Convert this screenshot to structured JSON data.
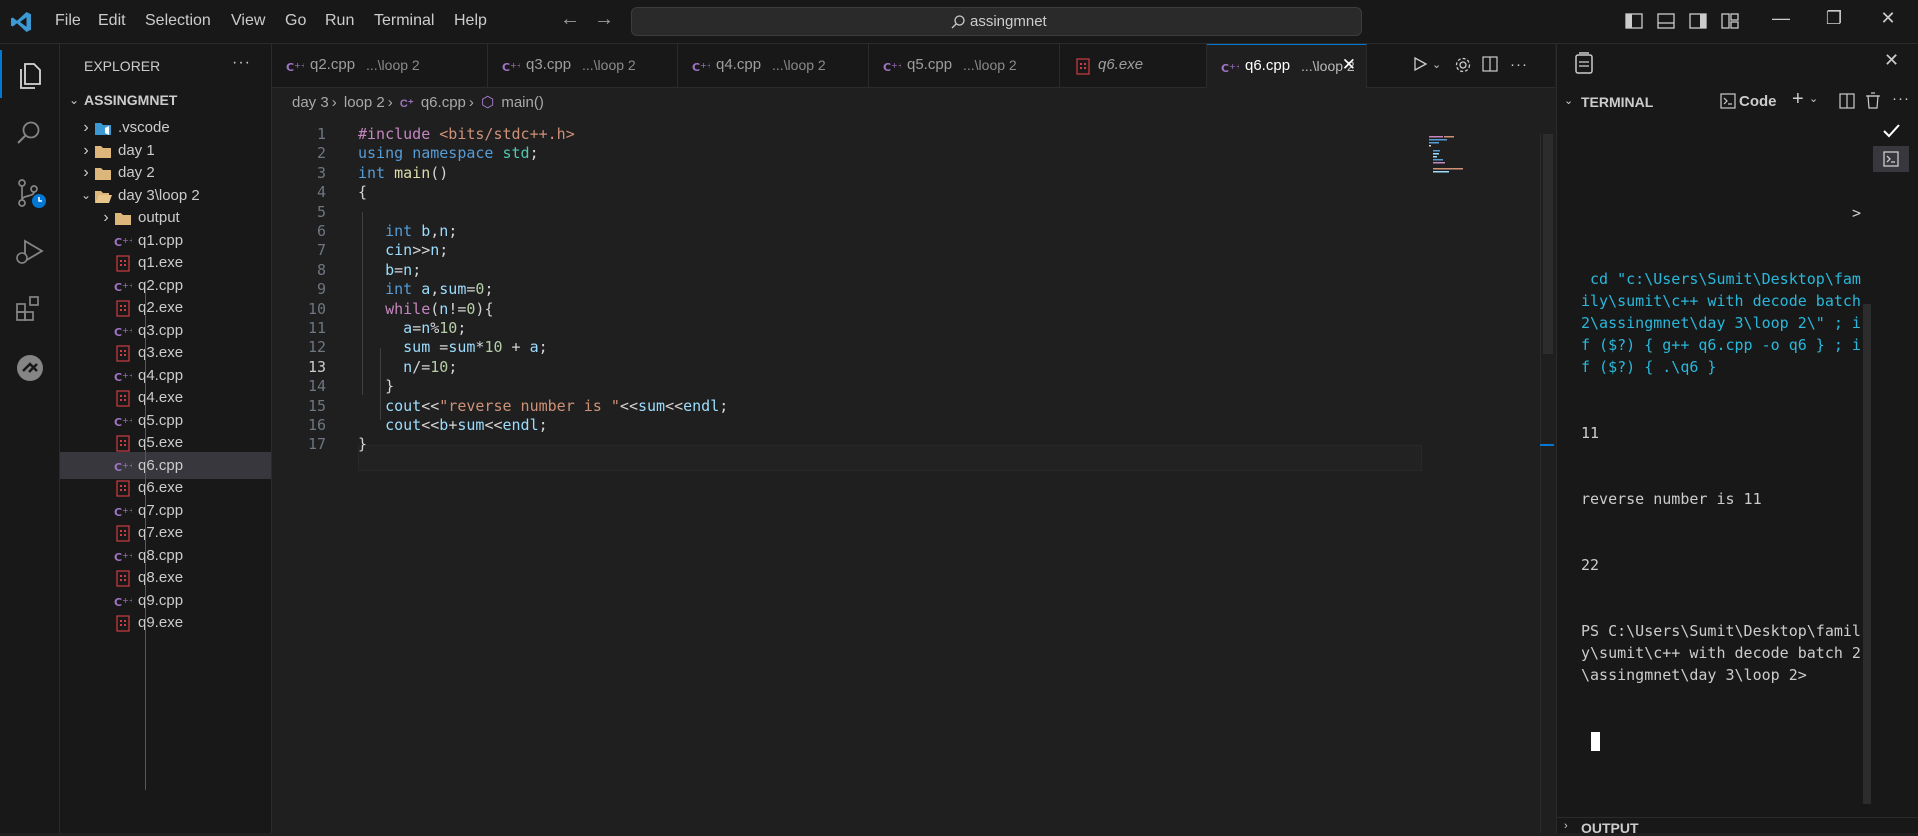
{
  "titlebar": {
    "menu": [
      "File",
      "Edit",
      "Selection",
      "View",
      "Go",
      "Run",
      "Terminal",
      "Help"
    ],
    "search_text": "assingmnet",
    "accent": "#0078d4"
  },
  "explorer": {
    "title": "EXPLORER",
    "more": "···",
    "root": "ASSINGMNET",
    "items": [
      {
        "label": ".vscode",
        "kind": "vscode-folder",
        "level": 1,
        "expanded": false
      },
      {
        "label": "day 1",
        "kind": "folder",
        "level": 1,
        "expanded": false
      },
      {
        "label": "day 2",
        "kind": "folder",
        "level": 1,
        "expanded": false
      },
      {
        "label": "day 3\\loop 2",
        "kind": "folder-open",
        "level": 1,
        "expanded": true
      },
      {
        "label": "output",
        "kind": "folder",
        "level": 2,
        "expanded": false
      },
      {
        "label": "q1.cpp",
        "kind": "cpp",
        "level": 2
      },
      {
        "label": "q1.exe",
        "kind": "exe",
        "level": 2
      },
      {
        "label": "q2.cpp",
        "kind": "cpp",
        "level": 2
      },
      {
        "label": "q2.exe",
        "kind": "exe",
        "level": 2
      },
      {
        "label": "q3.cpp",
        "kind": "cpp",
        "level": 2
      },
      {
        "label": "q3.exe",
        "kind": "exe",
        "level": 2
      },
      {
        "label": "q4.cpp",
        "kind": "cpp",
        "level": 2
      },
      {
        "label": "q4.exe",
        "kind": "exe",
        "level": 2
      },
      {
        "label": "q5.cpp",
        "kind": "cpp",
        "level": 2
      },
      {
        "label": "q5.exe",
        "kind": "exe",
        "level": 2
      },
      {
        "label": "q6.cpp",
        "kind": "cpp",
        "level": 2,
        "selected": true
      },
      {
        "label": "q6.exe",
        "kind": "exe",
        "level": 2
      },
      {
        "label": "q7.cpp",
        "kind": "cpp",
        "level": 2
      },
      {
        "label": "q7.exe",
        "kind": "exe",
        "level": 2
      },
      {
        "label": "q8.cpp",
        "kind": "cpp",
        "level": 2
      },
      {
        "label": "q8.exe",
        "kind": "exe",
        "level": 2
      },
      {
        "label": "q9.cpp",
        "kind": "cpp",
        "level": 2
      },
      {
        "label": "q9.exe",
        "kind": "exe",
        "level": 2
      }
    ]
  },
  "tabs": [
    {
      "name": "q2.cpp",
      "path": "...\\loop 2",
      "kind": "cpp",
      "active": false
    },
    {
      "name": "q3.cpp",
      "path": "...\\loop 2",
      "kind": "cpp",
      "active": false
    },
    {
      "name": "q4.cpp",
      "path": "...\\loop 2",
      "kind": "cpp",
      "active": false
    },
    {
      "name": "q5.cpp",
      "path": "...\\loop 2",
      "kind": "cpp",
      "active": false
    },
    {
      "name": "q6.exe",
      "path": "",
      "kind": "exe",
      "active": false
    },
    {
      "name": "q6.cpp",
      "path": "...\\loop 2",
      "kind": "cpp",
      "active": true
    }
  ],
  "breadcrumb": [
    "day 3",
    "loop 2",
    "q6.cpp",
    "main()"
  ],
  "code": {
    "current_line": 13,
    "lines": [
      "#include <bits/stdc++.h>",
      "using namespace std;",
      "int main()",
      "{",
      "",
      "   int b,n;",
      "   cin>>n;",
      "   b=n;",
      "   int a,sum=0;",
      "   while(n!=0){",
      "     a=n%10;",
      "     sum =sum*10 + a;",
      "     n/=10;",
      "   }",
      "   cout<<\"reverse number is \"<<sum<<endl;",
      "   cout<<b+sum<<endl;",
      "}"
    ]
  },
  "terminal": {
    "title": "TERMINAL",
    "shell_label": "Code",
    "output_title": "OUTPUT",
    "prompt_marker": ">",
    "command": " cd \"c:\\Users\\Sumit\\Desktop\\family\\sumit\\c++ with decode batch 2\\assingmnet\\day 3\\loop 2\\\" ; if ($?) { g++ q6.cpp -o q6 } ; if ($?) { .\\q6 }",
    "output_lines": [
      "11",
      "reverse number is 11",
      "22"
    ],
    "prompt": "PS C:\\Users\\Sumit\\Desktop\\family\\sumit\\c++ with decode batch 2\\assingmnet\\day 3\\loop 2>"
  }
}
